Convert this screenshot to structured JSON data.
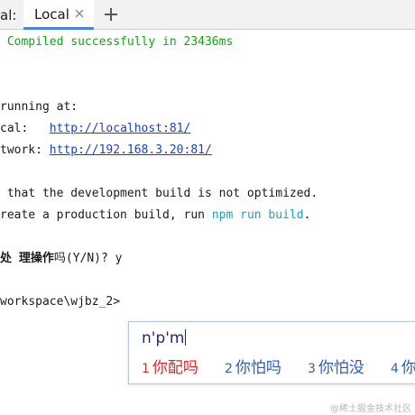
{
  "tabbar": {
    "prefix": "al:",
    "active_tab": "Local",
    "close_icon": "close-icon",
    "add_icon": "plus-icon"
  },
  "terminal": {
    "compiled": " Compiled successfully in 23436ms",
    "running_at": "running at:",
    "local_label": "cal:   ",
    "local_url": "http://localhost:81/",
    "network_label": "twork: ",
    "network_url": "http://192.168.3.20:81/",
    "note_1": " that the development build is not optimized.",
    "note_2_prefix": "reate a production build, run ",
    "note_2_command": "npm run build",
    "note_2_suffix": ".",
    "prompt_cjk_1": "处",
    "prompt_cjk_2": "理操作",
    "prompt_cjk_3": "吗",
    "prompt_tail": "(Y/N)? y",
    "path": "workspace\\wjbz_2>"
  },
  "ime": {
    "input": "n'p'm",
    "candidates": [
      {
        "num": "1",
        "text": "你配吗"
      },
      {
        "num": "2",
        "text": "你怕吗"
      },
      {
        "num": "3",
        "text": "你怕没"
      },
      {
        "num": "4",
        "text": "你"
      }
    ]
  },
  "watermark": "@稀土掘金技术社区",
  "colors": {
    "success": "#15a315",
    "link": "#1a43c8",
    "command": "#1aa3b8",
    "tab_accent": "#4a86d6",
    "ime_selected": "#d9262c",
    "ime_candidate": "#2d5fb0"
  }
}
